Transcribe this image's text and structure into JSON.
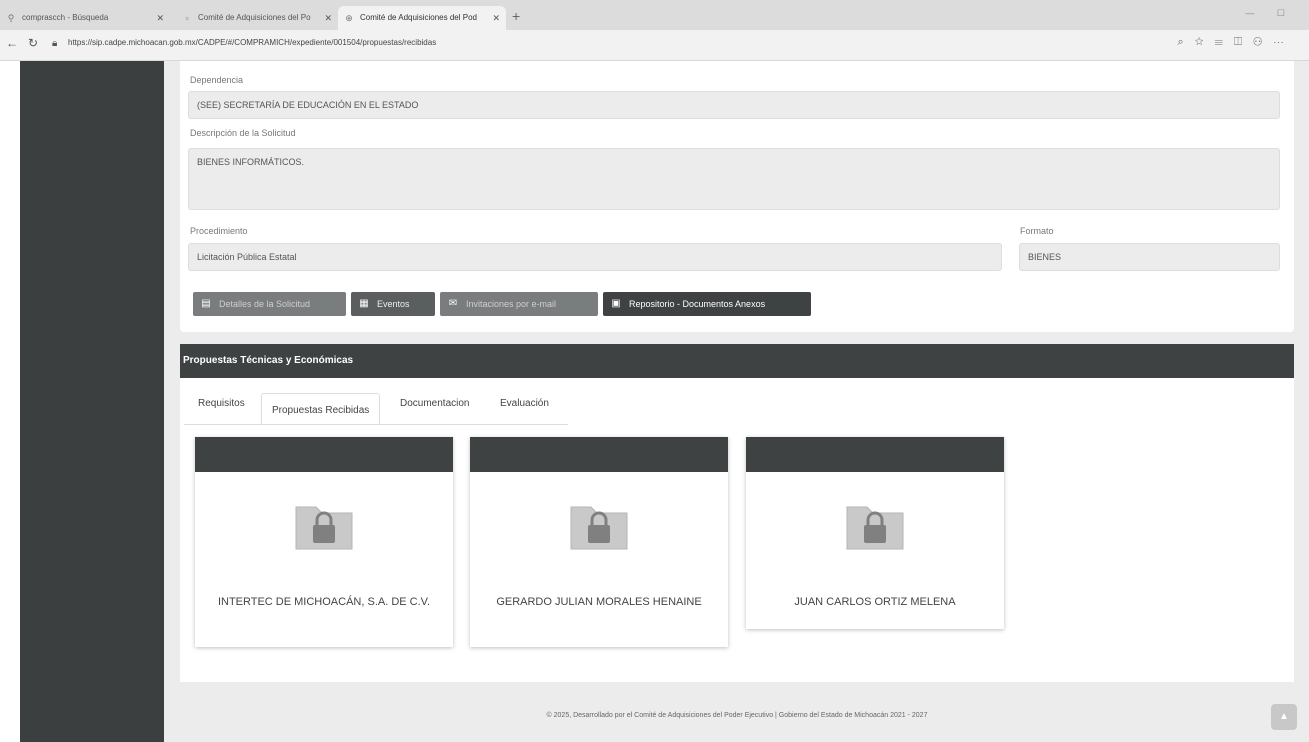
{
  "browser": {
    "tabs": [
      {
        "title": "comprascch - Búsqueda",
        "icon": "search-icon"
      },
      {
        "title": "Comité de Adquisiciones del Po",
        "icon": "page-icon"
      },
      {
        "title": "Comité de Adquisiciones del Pod",
        "icon": "globe-icon"
      }
    ],
    "url": "https://sip.cadpe.michoacan.gob.mx/CADPE/#/COMPRAMICH/expediente/001504/propuestas/recibidas"
  },
  "solicitud": {
    "dependencia_label": "Dependencia",
    "dependencia_value": "(SEE) SECRETARÍA DE EDUCACIÓN EN EL ESTADO",
    "descripcion_label": "Descripción de la Solicitud",
    "descripcion_value": "BIENES INFORMÁTICOS.",
    "procedimiento_label": "Procedimiento",
    "procedimiento_value": "Licitación Pública Estatal",
    "formato_label": "Formato",
    "formato_value": "BIENES"
  },
  "actions": {
    "detalles": "Detalles de la Solicitud",
    "eventos": "Eventos",
    "invitaciones": "Invitaciones por e-mail",
    "repositorio": "Repositorio - Documentos Anexos"
  },
  "propuestas": {
    "heading": "Propuestas Técnicas y Económicas",
    "tabs": [
      "Requisitos",
      "Propuestas Recibidas",
      "Documentacion",
      "Evaluación"
    ],
    "active_tab": "Propuestas Recibidas",
    "cards": [
      {
        "name": "INTERTEC DE MICHOACÁN, S.A. DE C.V."
      },
      {
        "name": "GERARDO JULIAN MORALES HENAINE"
      },
      {
        "name": "JUAN CARLOS ORTIZ MELENA"
      }
    ]
  },
  "footer": {
    "text": "© 2025, Desarrollado por el Comité de Adquisiciones del Poder Ejecutivo | Gobierno del Estado de Michoacán 2021 - 2027"
  },
  "colors": {
    "sidebar": "#3b3f3f",
    "header_bar": "#3e4242",
    "field_bg": "#ececec"
  }
}
